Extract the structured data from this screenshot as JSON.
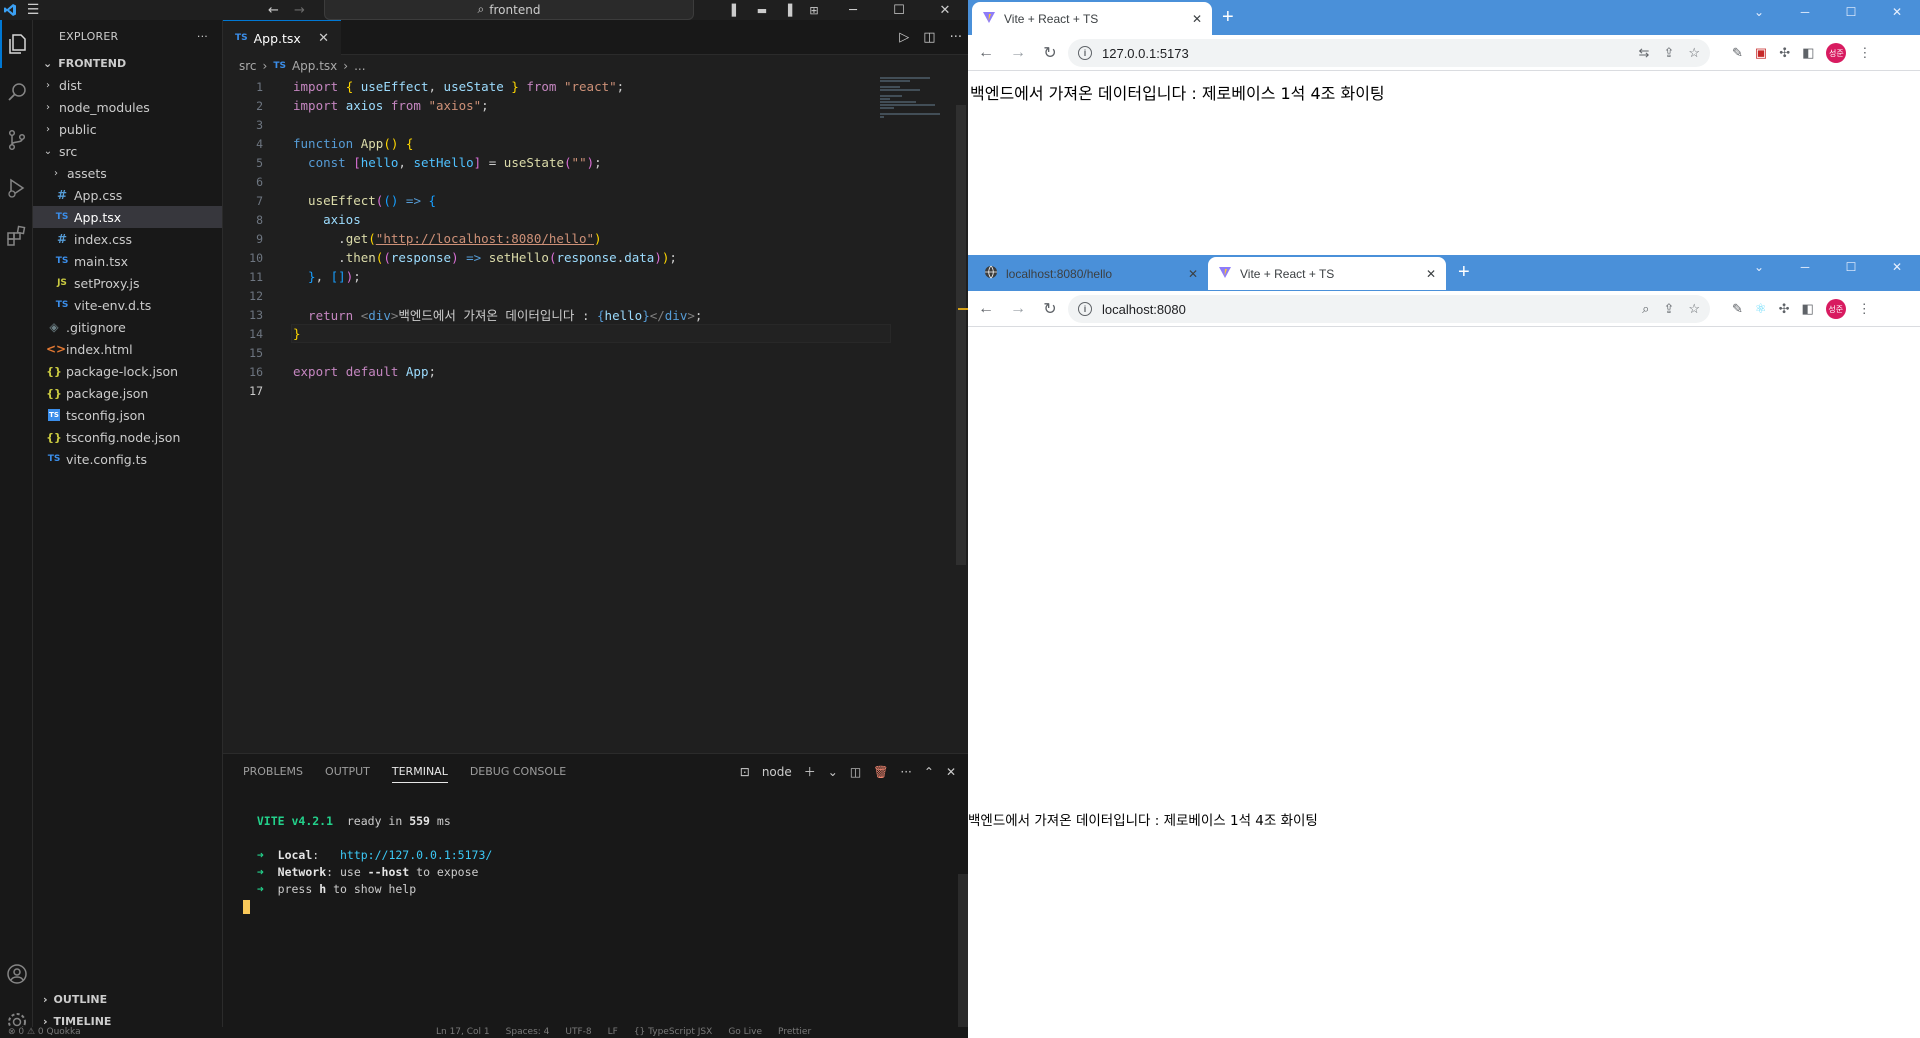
{
  "vscode": {
    "title_search": "frontend",
    "explorer_label": "EXPLORER",
    "root_folder": "FRONTEND",
    "tree": [
      {
        "name": "dist",
        "type": "folder",
        "depth": 0
      },
      {
        "name": "node_modules",
        "type": "folder",
        "depth": 0
      },
      {
        "name": "public",
        "type": "folder",
        "depth": 0
      },
      {
        "name": "src",
        "type": "folder-open",
        "depth": 0
      },
      {
        "name": "assets",
        "type": "folder",
        "depth": 1
      },
      {
        "name": "App.css",
        "type": "css",
        "depth": 1
      },
      {
        "name": "App.tsx",
        "type": "ts",
        "depth": 1,
        "active": true
      },
      {
        "name": "index.css",
        "type": "css",
        "depth": 1
      },
      {
        "name": "main.tsx",
        "type": "ts",
        "depth": 1
      },
      {
        "name": "setProxy.js",
        "type": "js",
        "depth": 1
      },
      {
        "name": "vite-env.d.ts",
        "type": "ts",
        "depth": 1
      },
      {
        "name": ".gitignore",
        "type": "git",
        "depth": 0
      },
      {
        "name": "index.html",
        "type": "html",
        "depth": 0
      },
      {
        "name": "package-lock.json",
        "type": "json",
        "depth": 0
      },
      {
        "name": "package.json",
        "type": "json",
        "depth": 0
      },
      {
        "name": "tsconfig.json",
        "type": "tscfg",
        "depth": 0
      },
      {
        "name": "tsconfig.node.json",
        "type": "json",
        "depth": 0
      },
      {
        "name": "vite.config.ts",
        "type": "ts",
        "depth": 0
      }
    ],
    "outline_label": "OUTLINE",
    "timeline_label": "TIMELINE",
    "tab_label": "App.tsx",
    "tab_prefix": "TS",
    "breadcrumb": {
      "folder": "src",
      "file": "App.tsx",
      "rest": "..."
    },
    "code_lines": [
      [
        [
          "import ",
          "#c586c0"
        ],
        [
          "{ ",
          "#ffd700"
        ],
        [
          "useEffect",
          "#9cdcfe"
        ],
        [
          ", ",
          "#ccc"
        ],
        [
          "useState",
          "#9cdcfe"
        ],
        [
          " } ",
          "#ffd700"
        ],
        [
          "from ",
          "#c586c0"
        ],
        [
          "\"react\"",
          "#ce9178"
        ],
        [
          ";",
          "#ccc"
        ]
      ],
      [
        [
          "import ",
          "#c586c0"
        ],
        [
          "axios ",
          "#9cdcfe"
        ],
        [
          "from ",
          "#c586c0"
        ],
        [
          "\"axios\"",
          "#ce9178"
        ],
        [
          ";",
          "#ccc"
        ]
      ],
      [],
      [
        [
          "function ",
          "#569cd6"
        ],
        [
          "App",
          "#dcdcaa"
        ],
        [
          "() ",
          "#ffd700"
        ],
        [
          "{",
          "#ffd700"
        ]
      ],
      [
        [
          "  const ",
          "#569cd6"
        ],
        [
          "[",
          "#da70d6"
        ],
        [
          "hello",
          "#4fc1ff"
        ],
        [
          ", ",
          "#ccc"
        ],
        [
          "setHello",
          "#4fc1ff"
        ],
        [
          "] ",
          "#da70d6"
        ],
        [
          "= ",
          "#ccc"
        ],
        [
          "useState",
          "#dcdcaa"
        ],
        [
          "(",
          "#da70d6"
        ],
        [
          "\"\"",
          "#ce9178"
        ],
        [
          ")",
          "#da70d6"
        ],
        [
          ";",
          "#ccc"
        ]
      ],
      [],
      [
        [
          "  useEffect",
          "#dcdcaa"
        ],
        [
          "(",
          "#da70d6"
        ],
        [
          "(",
          "#179fff"
        ],
        [
          ") ",
          "#179fff"
        ],
        [
          "=> ",
          "#569cd6"
        ],
        [
          "{",
          "#179fff"
        ]
      ],
      [
        [
          "    axios",
          "#9cdcfe"
        ]
      ],
      [
        [
          "      .",
          "#ccc"
        ],
        [
          "get",
          "#dcdcaa"
        ],
        [
          "(",
          "#ffd700"
        ],
        [
          "\"http://localhost:8080/hello\"",
          "#ce9178"
        ],
        [
          ")",
          "#ffd700"
        ]
      ],
      [
        [
          "      .",
          "#ccc"
        ],
        [
          "then",
          "#dcdcaa"
        ],
        [
          "(",
          "#ffd700"
        ],
        [
          "(",
          "#da70d6"
        ],
        [
          "response",
          "#9cdcfe"
        ],
        [
          ") ",
          "#da70d6"
        ],
        [
          "=> ",
          "#569cd6"
        ],
        [
          "setHello",
          "#dcdcaa"
        ],
        [
          "(",
          "#da70d6"
        ],
        [
          "response",
          "#9cdcfe"
        ],
        [
          ".",
          "#ccc"
        ],
        [
          "data",
          "#9cdcfe"
        ],
        [
          ")",
          "#da70d6"
        ],
        [
          ")",
          "#ffd700"
        ],
        [
          ";",
          "#ccc"
        ]
      ],
      [
        [
          "  }",
          "#179fff"
        ],
        [
          ", ",
          "#ccc"
        ],
        [
          "[]",
          "#179fff"
        ],
        [
          ")",
          "#da70d6"
        ],
        [
          ";",
          "#ccc"
        ]
      ],
      [],
      [
        [
          "  return ",
          "#c586c0"
        ],
        [
          "<",
          "#808080"
        ],
        [
          "div",
          "#569cd6"
        ],
        [
          ">",
          "#808080"
        ],
        [
          "백엔드에서 가져온 데이터입니다 : ",
          "#ccc"
        ],
        [
          "{",
          "#569cd6"
        ],
        [
          "hello",
          "#9cdcfe"
        ],
        [
          "}",
          "#569cd6"
        ],
        [
          "</",
          "#808080"
        ],
        [
          "div",
          "#569cd6"
        ],
        [
          ">",
          "#808080"
        ],
        [
          ";",
          "#ccc"
        ]
      ],
      [
        [
          "}",
          "#ffd700"
        ]
      ],
      [],
      [
        [
          "export ",
          "#c586c0"
        ],
        [
          "default ",
          "#c586c0"
        ],
        [
          "App",
          "#9cdcfe"
        ],
        [
          ";",
          "#ccc"
        ]
      ],
      []
    ],
    "panel_tabs": [
      "PROBLEMS",
      "OUTPUT",
      "TERMINAL",
      "DEBUG CONSOLE"
    ],
    "active_panel_tab": "TERMINAL",
    "terminal_shell": "node",
    "terminal": {
      "vite": "VITE v4.2.1",
      "ready_pre": "  ready in ",
      "ready_ms": "559",
      "ready_post": " ms",
      "local_label": "Local",
      "local_url": "http://127.0.0.1:5173/",
      "network_label": "Network",
      "network_text_pre": ": use ",
      "network_host": "--host",
      "network_text_post": " to expose",
      "help_pre": "press ",
      "help_key": "h",
      "help_post": " to show help"
    },
    "status": {
      "left": "⊗ 0 ⚠ 0   Quokka",
      "items": [
        "Ln 17, Col 1",
        "Spaces: 4",
        "UTF-8",
        "LF",
        "{} TypeScript JSX",
        "Go Live",
        "Prettier"
      ]
    }
  },
  "chrome_top": {
    "tabs": [
      {
        "title": "Vite + React + TS",
        "active": true,
        "favicon": "vite-icon"
      }
    ],
    "url": "127.0.0.1:5173",
    "content": "백엔드에서 가져온 데이터입니다 : 제로베이스 1석 4조 화이팅",
    "avatar": "성준"
  },
  "chrome_bottom": {
    "tabs": [
      {
        "title": "localhost:8080/hello",
        "active": false,
        "favicon": "globe-icon"
      },
      {
        "title": "Vite + React + TS",
        "active": true,
        "favicon": "vite-icon"
      }
    ],
    "url": "localhost:8080",
    "content": "백엔드에서 가져온 데이터입니다 : 제로베이스 1석 4조 화이팅",
    "avatar": "성준"
  },
  "colors": {
    "vscode_bg": "#1f1f1f",
    "chrome_frame": "#4a90d9",
    "accent": "#0078d4"
  }
}
